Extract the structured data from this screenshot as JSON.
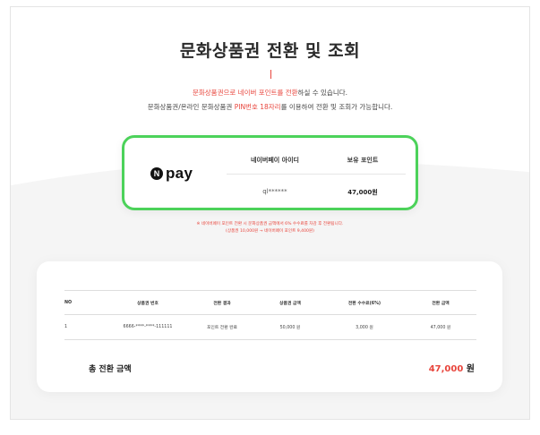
{
  "page": {
    "title": "문화상품권 전환 및 조회",
    "desc_line1": {
      "highlight": "문화상품권으로 네이버 포인트를 전환",
      "rest": "하실 수 있습니다."
    },
    "desc_line2": {
      "part1": "문화상품권/온라인 문화상품권 ",
      "highlight": "PIN번호 18자리",
      "part2": "를 이용하여 전환 및 조회가 가능합니다."
    }
  },
  "pay_card": {
    "logo_letter": "N",
    "logo_text": "pay",
    "col_id_header": "네이버페이 아이디",
    "col_points_header": "보유 포인트",
    "id_value": "ql******",
    "points_value": "47,000원"
  },
  "notice": {
    "line1": "※ 네이버페이 포인트 전환 시 문화상품권 금액에서 6% 수수료를 차감 후 전환됩니다.",
    "line2": "(상품권 10,000원 → 네이버페이 포인트 9,400원)"
  },
  "table": {
    "headers": [
      "NO",
      "상품권 번호",
      "전환 결과",
      "상품권 금액",
      "전환 수수료(6%)",
      "전환 금액"
    ],
    "rows": [
      [
        "1",
        "6666-****-****-111111",
        "포인트 전환 완료",
        "50,000 원",
        "3,000 원",
        "47,000 원"
      ]
    ]
  },
  "total": {
    "label": "총 전환 금액",
    "amount": "47,000",
    "unit": "원"
  },
  "colors": {
    "accent_red": "#e8453c",
    "npay_green": "#4cd25a"
  }
}
